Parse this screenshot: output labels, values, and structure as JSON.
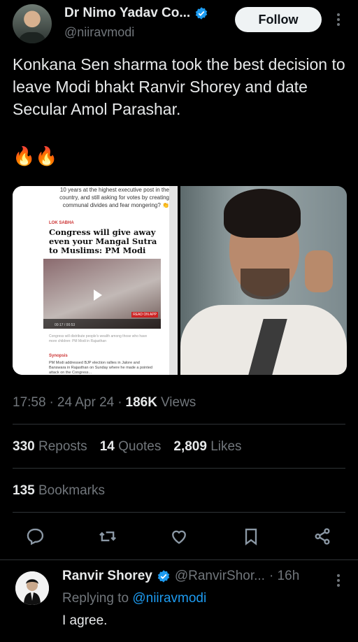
{
  "author": {
    "name": "Dr Nimo Yadav Co...",
    "handle": "@niiravmodi",
    "follow_label": "Follow"
  },
  "tweet": {
    "text": "Konkana Sen sharma took the best decision to leave Modi bhakt Ranvir Shorey and date Secular Amol Parashar.",
    "emoji": "🔥🔥"
  },
  "media_left": {
    "snippet": "10 years at the highest executive post in the country, and still asking for votes by creating communal divides and fear mongering? 👏",
    "section": "LOK SABHA",
    "headline": "Congress will give away even your Mangal Sutra to Muslims: PM Modi",
    "video_time": "00:17 / 00:53",
    "read_badge": "READ ON APP",
    "caption": "Congress will distribute people's wealth among those who have more children: PM Modi in Rajasthan",
    "synopsis_label": "Synopsis",
    "synopsis": "PM Modi addressed BJP election rallies in Jalore and Banswara in Rajasthan on Sunday where he made a pointed attack on the Congress..."
  },
  "meta": {
    "time": "17:58",
    "date": "24 Apr 24",
    "views_count": "186K",
    "views_label": "Views"
  },
  "stats": {
    "reposts_count": "330",
    "reposts_label": "Reposts",
    "quotes_count": "14",
    "quotes_label": "Quotes",
    "likes_count": "2,809",
    "likes_label": "Likes",
    "bookmarks_count": "135",
    "bookmarks_label": "Bookmarks"
  },
  "actions": [
    "reply-icon",
    "repost-icon",
    "like-icon",
    "bookmark-icon",
    "share-icon"
  ],
  "reply": {
    "name": "Ranvir Shorey",
    "handle": "@RanvirShor...",
    "time": "· 16h",
    "replying_prefix": "Replying to",
    "replying_to": "@niiravmodi",
    "text": "I agree."
  },
  "colors": {
    "background": "#000000",
    "text": "#e7e9ea",
    "muted": "#71767b",
    "accent": "#1d9bf0",
    "divider": "#2f3336"
  }
}
